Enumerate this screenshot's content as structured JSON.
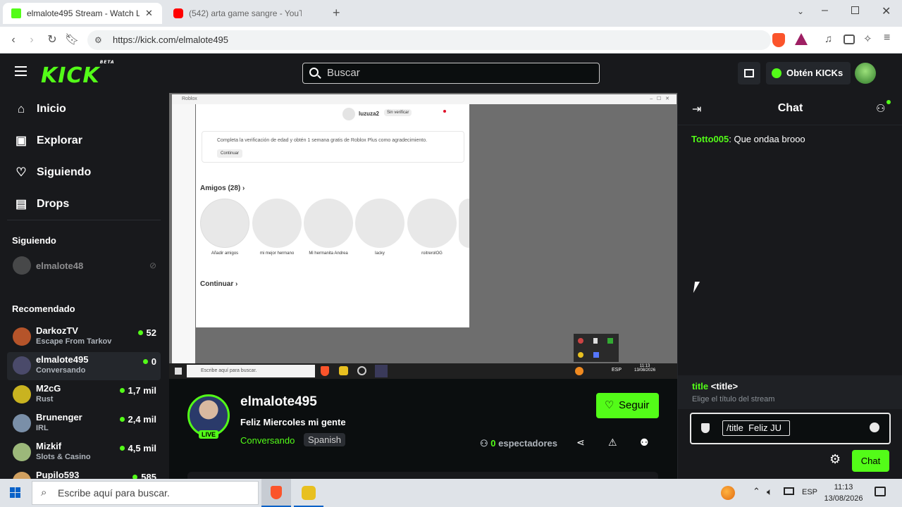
{
  "browser": {
    "tabs": [
      {
        "label": "elmalote495 Stream - Watch Live",
        "active": true
      },
      {
        "label": "(542) arta game sangre - YouTube",
        "active": false
      }
    ],
    "url": "https://kick.com/elmalote495"
  },
  "kick": {
    "logo": "KICK",
    "logo_tag": "BETA",
    "search_placeholder": "Buscar",
    "get_kicks": "Obtén KICKs"
  },
  "sidebar": {
    "nav": [
      {
        "label": "Inicio",
        "icon": "home-icon"
      },
      {
        "label": "Explorar",
        "icon": "explore-icon"
      },
      {
        "label": "Siguiendo",
        "icon": "heart-icon"
      },
      {
        "label": "Drops",
        "icon": "drops-icon"
      }
    ],
    "following_heading": "Siguiendo",
    "following": [
      {
        "name": "elmalote48"
      }
    ],
    "recommended_heading": "Recomendado",
    "recommended": [
      {
        "name": "DarkozTV",
        "category": "Escape From Tarkov",
        "viewers": "52",
        "color": "#b5542a"
      },
      {
        "name": "elmalote495",
        "category": "Conversando",
        "viewers": "0",
        "color": "#4a4a6a"
      },
      {
        "name": "M2cG",
        "category": "Rust",
        "viewers": "1,7 mil",
        "color": "#c9b320"
      },
      {
        "name": "Brunenger",
        "category": "IRL",
        "viewers": "2,4 mil",
        "color": "#7a8fa8"
      },
      {
        "name": "Mizkif",
        "category": "Slots & Casino",
        "viewers": "4,5 mil",
        "color": "#9cb87a"
      },
      {
        "name": "Pupilo593",
        "category": "",
        "viewers": "585",
        "color": "#d0a060"
      }
    ]
  },
  "stream": {
    "roblox_title": "Roblox",
    "roblox_user": "luzuza2",
    "roblox_badge": "Sin verificar",
    "roblox_notice": "Completa la verificación de edad y obtén 1 semana gratis de Roblox Plus como agradecimiento.",
    "roblox_continue_btn": "Continuar",
    "friends_heading": "Amigos (28)",
    "friends": [
      "Añadir amigos",
      "mi mejor hermano",
      "Mi hermanita Andrea",
      "lacky",
      "roitrerolOG"
    ],
    "continuar": "Continuar",
    "inner_search": "Escribe aquí para buscar.",
    "inner_lang": "ESP",
    "inner_time": "11:13",
    "inner_date": "13/08/2026"
  },
  "channel": {
    "name": "elmalote495",
    "title": "Feliz Miercoles mi gente",
    "category": "Conversando",
    "language": "Spanish",
    "live_badge": "LIVE",
    "follow_label": "Seguir",
    "viewers_count": "0",
    "viewers_label": "espectadores"
  },
  "chat": {
    "header": "Chat",
    "messages": [
      {
        "user": "Totto005",
        "text": "Que ondaa brooo",
        "color": "#53fc18"
      }
    ],
    "command_name": "title",
    "command_param": "<title>",
    "command_desc": "Elige el título del stream",
    "input_value": "/title  Feliz JU",
    "send_label": "Chat"
  },
  "taskbar": {
    "search_placeholder": "Escribe aquí para buscar.",
    "lang": "ESP",
    "time": "11:13",
    "date": "13/08/2026"
  },
  "colors": {
    "kick_green": "#53fc18",
    "bg": "#0b0e0f",
    "panel": "#18191c"
  }
}
